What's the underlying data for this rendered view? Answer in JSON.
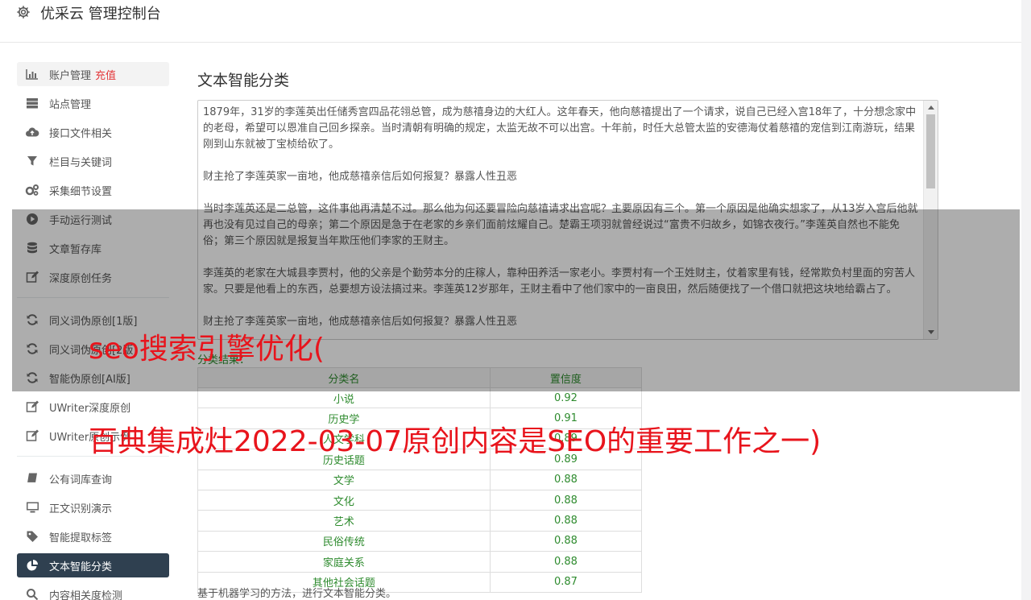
{
  "header": {
    "title": "优采云 管理控制台"
  },
  "sidebar": {
    "items": [
      {
        "label": "账户管理",
        "badge": "充值",
        "icon": "bar-chart-icon"
      },
      {
        "label": "站点管理",
        "icon": "server-icon"
      },
      {
        "label": "接口文件相关",
        "icon": "cloud-upload-icon"
      },
      {
        "label": "栏目与关键词",
        "icon": "filter-icon"
      },
      {
        "label": "采集细节设置",
        "icon": "gears-icon"
      },
      {
        "label": "手动运行测试",
        "icon": "play-circle-icon"
      },
      {
        "label": "文章暂存库",
        "icon": "database-icon"
      },
      {
        "label": "深度原创任务",
        "icon": "edit-icon"
      },
      {
        "label": "同义词伪原创[1版]",
        "icon": "refresh-icon"
      },
      {
        "label": "同义词伪原创[2版]",
        "icon": "refresh-icon"
      },
      {
        "label": "智能伪原创[AI版]",
        "icon": "refresh-icon"
      },
      {
        "label": "UWriter深度原创",
        "icon": "edit-icon"
      },
      {
        "label": "UWriter原创示例",
        "icon": "edit-icon"
      },
      {
        "label": "公有词库查询",
        "icon": "book-icon"
      },
      {
        "label": "正文识别演示",
        "icon": "monitor-icon"
      },
      {
        "label": "智能提取标签",
        "icon": "tag-icon"
      },
      {
        "label": "文本智能分类",
        "icon": "pie-chart-icon"
      },
      {
        "label": "内容相关度检测",
        "icon": "search-icon"
      }
    ]
  },
  "main": {
    "title": "文本智能分类",
    "text_paragraphs": [
      "1879年，31岁的李莲英出任储秀宫四品花翎总管，成为慈禧身边的大红人。这年春天，他向慈禧提出了一个请求，说自己已经入宫18年了，十分想念家中的老母，希望可以恩准自己回乡探亲。当时清朝有明确的规定，太监无故不可以出宫。十年前，时任大总管太监的安德海仗着慈禧的宠信到江南游玩，结果刚到山东就被丁宝桢给砍了。",
      "财主抢了李莲英家一亩地，他成慈禧亲信后如何报复？暴露人性丑恶",
      "当时李莲英还是二总管，这件事他再清楚不过。那么他为何还要冒险向慈禧请求出宫呢？主要原因有三个。第一个原因是他确实想家了，从13岁入宫后他就再也没有见过自己的母亲；第二个原因是急于在老家的乡亲们面前炫耀自己。楚霸王项羽就曾经说过“富贵不归故乡，如锦衣夜行。”李莲英自然也不能免俗；第三个原因就是报复当年欺压他们李家的王财主。",
      "李莲英的老家在大城县李贾村，他的父亲是个勤劳本分的庄稼人，靠种田养活一家老小。李贾村有一个王姓财主，仗着家里有钱，经常欺负村里面的穷苦人家。只要是他看上的东西，总要想方设法搞过来。李莲英12岁那年，王财主看中了他们家中的一亩良田，然后随便找了一个借口就把这块地给霸占了。",
      "财主抢了李莲英家一亩地，他成慈禧亲信后如何报复？暴露人性丑恶"
    ],
    "result_label": "分类结果：",
    "table": {
      "headers": [
        "分类名",
        "置信度"
      ],
      "rows": [
        [
          "小说",
          "0.92"
        ],
        [
          "历史学",
          "0.91"
        ],
        [
          "人文学科",
          "0.89"
        ],
        [
          "历史话题",
          "0.89"
        ],
        [
          "文学",
          "0.88"
        ],
        [
          "文化",
          "0.88"
        ],
        [
          "艺术",
          "0.88"
        ],
        [
          "民俗传统",
          "0.88"
        ],
        [
          "家庭关系",
          "0.88"
        ],
        [
          "其他社会话题",
          "0.87"
        ]
      ]
    },
    "note": "基于机器学习的方法，进行文本智能分类。"
  },
  "watermark": {
    "line1": "seo搜索引擎优化(",
    "line2": "百典集成灶2022-03-07原创内容是SEO的重要工作之一)"
  },
  "colors": {
    "active_bg": "#2f4050",
    "badge": "#e4393c",
    "result": "#2e8b2e",
    "watermark": "#e8141c"
  }
}
